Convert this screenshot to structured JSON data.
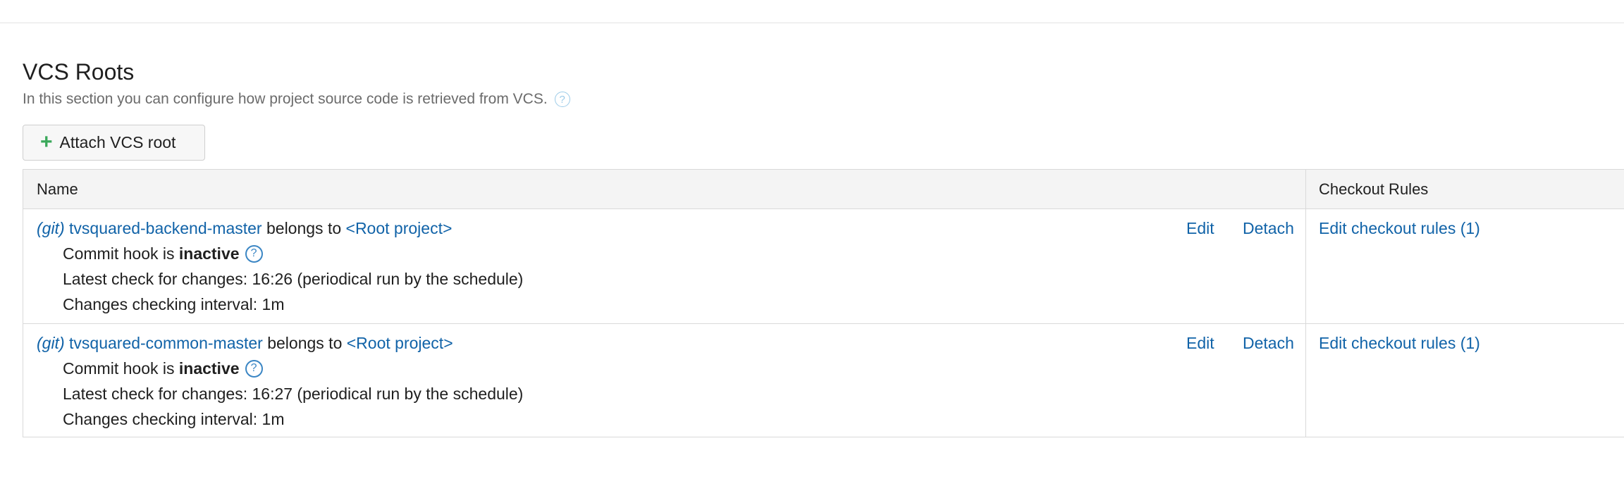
{
  "section": {
    "title": "VCS Roots",
    "description": "In this section you can configure how project source code is retrieved from VCS.",
    "help_icon": "question-circle-icon",
    "attach_button": {
      "icon": "plus-icon",
      "label": "Attach VCS root"
    }
  },
  "table": {
    "headers": {
      "name": "Name",
      "checkout_rules": "Checkout Rules"
    },
    "rows": [
      {
        "vcs_type": "(git)",
        "name": "tvsquared-backend-master",
        "belongs_text": "belongs to",
        "project": "<Root project>",
        "commit_hook_prefix": "Commit hook is",
        "commit_hook_status": "inactive",
        "latest_check": "Latest check for changes: 16:26 (periodical run by the schedule)",
        "interval": "Changes checking interval: 1m",
        "edit_label": "Edit",
        "detach_label": "Detach",
        "checkout_rules_label": "Edit checkout rules (1)"
      },
      {
        "vcs_type": "(git)",
        "name": "tvsquared-common-master",
        "belongs_text": "belongs to",
        "project": "<Root project>",
        "commit_hook_prefix": "Commit hook is",
        "commit_hook_status": "inactive",
        "latest_check": "Latest check for changes: 16:27 (periodical run by the schedule)",
        "interval": "Changes checking interval: 1m",
        "edit_label": "Edit",
        "detach_label": "Detach",
        "checkout_rules_label": "Edit checkout rules (1)"
      }
    ]
  },
  "colors": {
    "link": "#1163a8",
    "accent_plus": "#3aa85a",
    "header_bg": "#f4f4f4"
  }
}
